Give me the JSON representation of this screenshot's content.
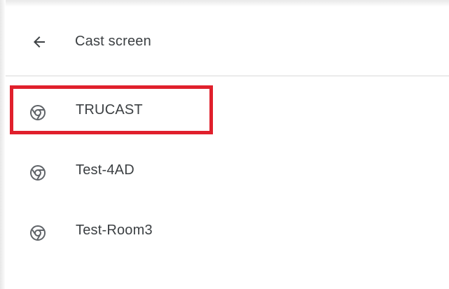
{
  "header": {
    "title": "Cast screen",
    "back_icon": "arrow-left-icon"
  },
  "devices": [
    {
      "label": "TRUCAST",
      "icon": "chromecast-icon",
      "highlighted": true
    },
    {
      "label": "Test-4AD",
      "icon": "chromecast-icon",
      "highlighted": false
    },
    {
      "label": "Test-Room3",
      "icon": "chromecast-icon",
      "highlighted": false
    }
  ],
  "colors": {
    "text": "#3c4043",
    "highlight": "#e0202c",
    "divider": "#d9d9d9",
    "icon": "#5f6368"
  }
}
